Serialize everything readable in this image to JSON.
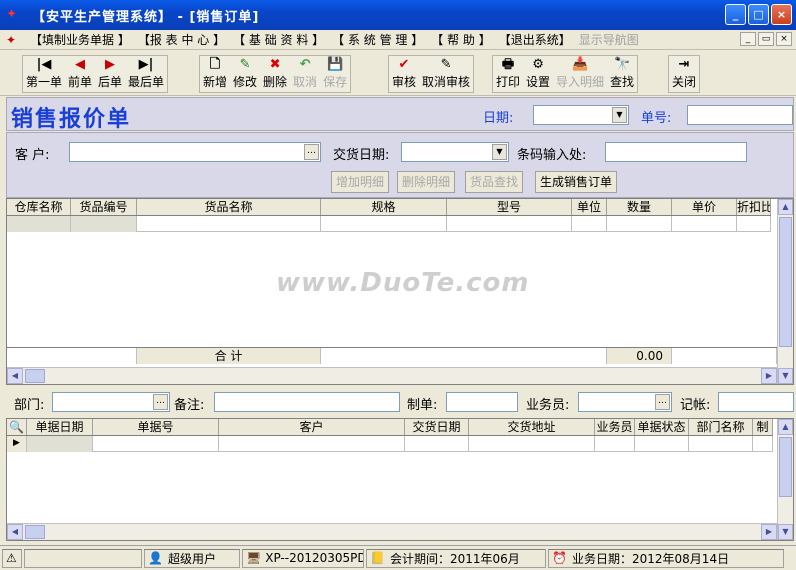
{
  "window": {
    "title": "【安平生产管理系统】 - [销售订单]",
    "min": "_",
    "max": "□",
    "close": "×"
  },
  "menu": {
    "items": [
      "【填制业务单据 】",
      "【报 表 中 心 】",
      "【 基 础 资 料 】",
      "【 系 统 管 理 】",
      "【 帮 助 】",
      "【退出系统】"
    ],
    "nav_hint": "显示导航图",
    "mdi": [
      "_",
      "▭",
      "×"
    ]
  },
  "toolbar": {
    "nav": [
      {
        "label": "第一单",
        "icon": "first-icon",
        "glyph": "|◀",
        "enabled": true
      },
      {
        "label": "前单",
        "icon": "prev-icon",
        "glyph": "◀",
        "enabled": true
      },
      {
        "label": "后单",
        "icon": "next-icon",
        "glyph": "▶",
        "enabled": true
      },
      {
        "label": "最后单",
        "icon": "last-icon",
        "glyph": "▶|",
        "enabled": true
      }
    ],
    "edit": [
      {
        "label": "新增",
        "icon": "new-doc-icon",
        "glyph": "🗋",
        "enabled": true
      },
      {
        "label": "修改",
        "icon": "edit-icon",
        "glyph": "✎",
        "enabled": true
      },
      {
        "label": "删除",
        "icon": "delete-icon",
        "glyph": "✖",
        "enabled": true
      },
      {
        "label": "取消",
        "icon": "undo-icon",
        "glyph": "↶",
        "enabled": false
      },
      {
        "label": "保存",
        "icon": "save-icon",
        "glyph": "💾",
        "enabled": false
      }
    ],
    "audit": [
      {
        "label": "审核",
        "icon": "check-icon",
        "glyph": "✔",
        "enabled": true
      },
      {
        "label": "取消审核",
        "icon": "uncheck-icon",
        "glyph": "✎",
        "enabled": true
      }
    ],
    "tools": [
      {
        "label": "打印",
        "icon": "print-icon",
        "glyph": "🖶",
        "enabled": true
      },
      {
        "label": "设置",
        "icon": "settings-icon",
        "glyph": "⚙",
        "enabled": true
      },
      {
        "label": "导入明细",
        "icon": "import-icon",
        "glyph": "📥",
        "enabled": false
      },
      {
        "label": "查找",
        "icon": "find-icon",
        "glyph": "🔭",
        "enabled": true
      }
    ],
    "close": {
      "label": "关闭",
      "icon": "exit-icon",
      "glyph": "⇥"
    }
  },
  "form": {
    "title": "销售报价单",
    "date_label": "日期:",
    "date_value": "",
    "number_label": "单号:",
    "number_value": "",
    "customer_label": "客  户:",
    "customer_value": "",
    "delivery_label": "交货日期:",
    "delivery_value": "",
    "barcode_label": "条码输入处:",
    "barcode_value": "",
    "buttons": {
      "add_detail": "增加明细",
      "delete_detail": "删除明细",
      "find_goods": "货品查找",
      "gen_order": "生成销售订单"
    }
  },
  "detail_grid": {
    "columns": [
      "仓库名称",
      "货品编号",
      "货品名称",
      "规格",
      "型号",
      "单位",
      "数量",
      "单价",
      "折扣比"
    ],
    "sum_label": "合      计",
    "sum_qty": "0.00"
  },
  "footer": {
    "dept_label": "部门:",
    "dept_value": "",
    "remark_label": "备注:",
    "remark_value": "",
    "maker_label": "制单:",
    "maker_value": "",
    "sales_label": "业务员:",
    "sales_value": "",
    "post_label": "记帐:",
    "post_value": ""
  },
  "list_grid": {
    "columns": [
      "单据日期",
      "单据号",
      "客户",
      "交货日期",
      "交货地址",
      "业务员",
      "单据状态",
      "部门名称",
      "制"
    ]
  },
  "watermark": "www.DuoTe.com",
  "status": {
    "user": "超级用户",
    "machine": "XP--20120305PDS",
    "period": "会计期间：2011年06月",
    "bizdate": "业务日期：2012年08月14日"
  }
}
